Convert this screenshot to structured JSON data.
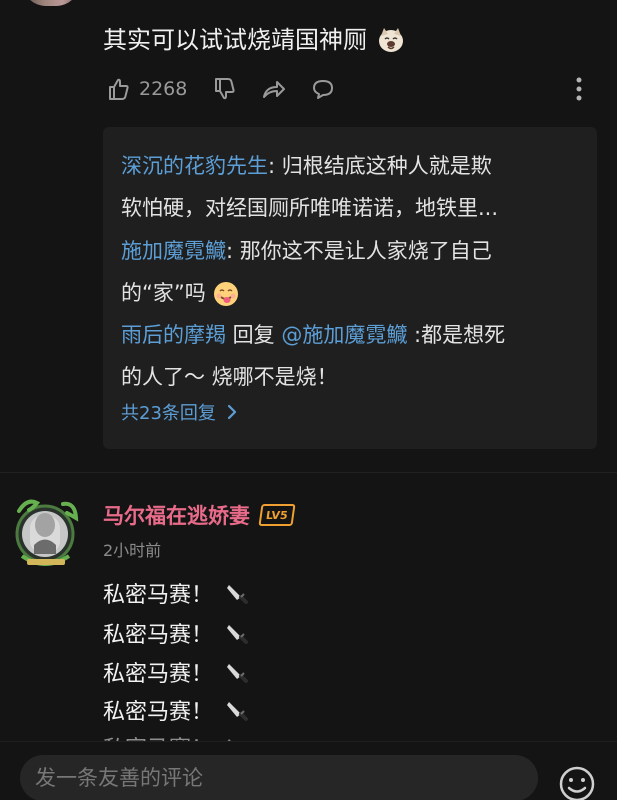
{
  "comment_top": {
    "text": "其实可以试试烧靖国神厕",
    "emoji_icon": "dog-face-emoji",
    "likes": "2268"
  },
  "actions": {
    "like_icon": "thumb-up-icon",
    "dislike_icon": "thumb-down-icon",
    "share_icon": "share-icon",
    "reply_icon": "reply-bubble-icon",
    "more_icon": "more-vertical-icon"
  },
  "replies": [
    {
      "name": "深沉的花豹先生",
      "separator": ":",
      "text_line1": " 归根结底这种人就是欺",
      "text_line2": "软怕硬，对经国厕所唯唯诺诺，地铁里..."
    },
    {
      "name": "施加魔霓鱵",
      "separator": ":",
      "text_line1": " 那你这不是让人家烧了自己",
      "text_line2": "的“家”吗",
      "emoji_icon": "tongue-out-emoji"
    },
    {
      "name": "雨后的摩羯",
      "reply_label": " 回复 ",
      "mention": "@施加魔霓鱵",
      "text_line1": " :都是想死",
      "text_line2": "的人了～ 烧哪不是烧！"
    }
  ],
  "more_replies": {
    "label": "共23条回复"
  },
  "comment_main": {
    "username": "马尔福在逃娇妻",
    "level": "LV5",
    "time": "2小时前",
    "lines": [
      "私密马赛！",
      "私密马赛！",
      "私密马赛！",
      "私密马赛！",
      "私密马赛！"
    ],
    "line_emoji": "kitchen-knife-emoji"
  },
  "bottom_bar": {
    "placeholder": "发一条友善的评论",
    "emoji_button": "smile-icon"
  },
  "colors": {
    "background": "#141414",
    "reply_box": "#1f1f1f",
    "link_blue": "#5c9ed6",
    "username_pink": "#e86b8a",
    "level_orange": "#f0a030"
  }
}
